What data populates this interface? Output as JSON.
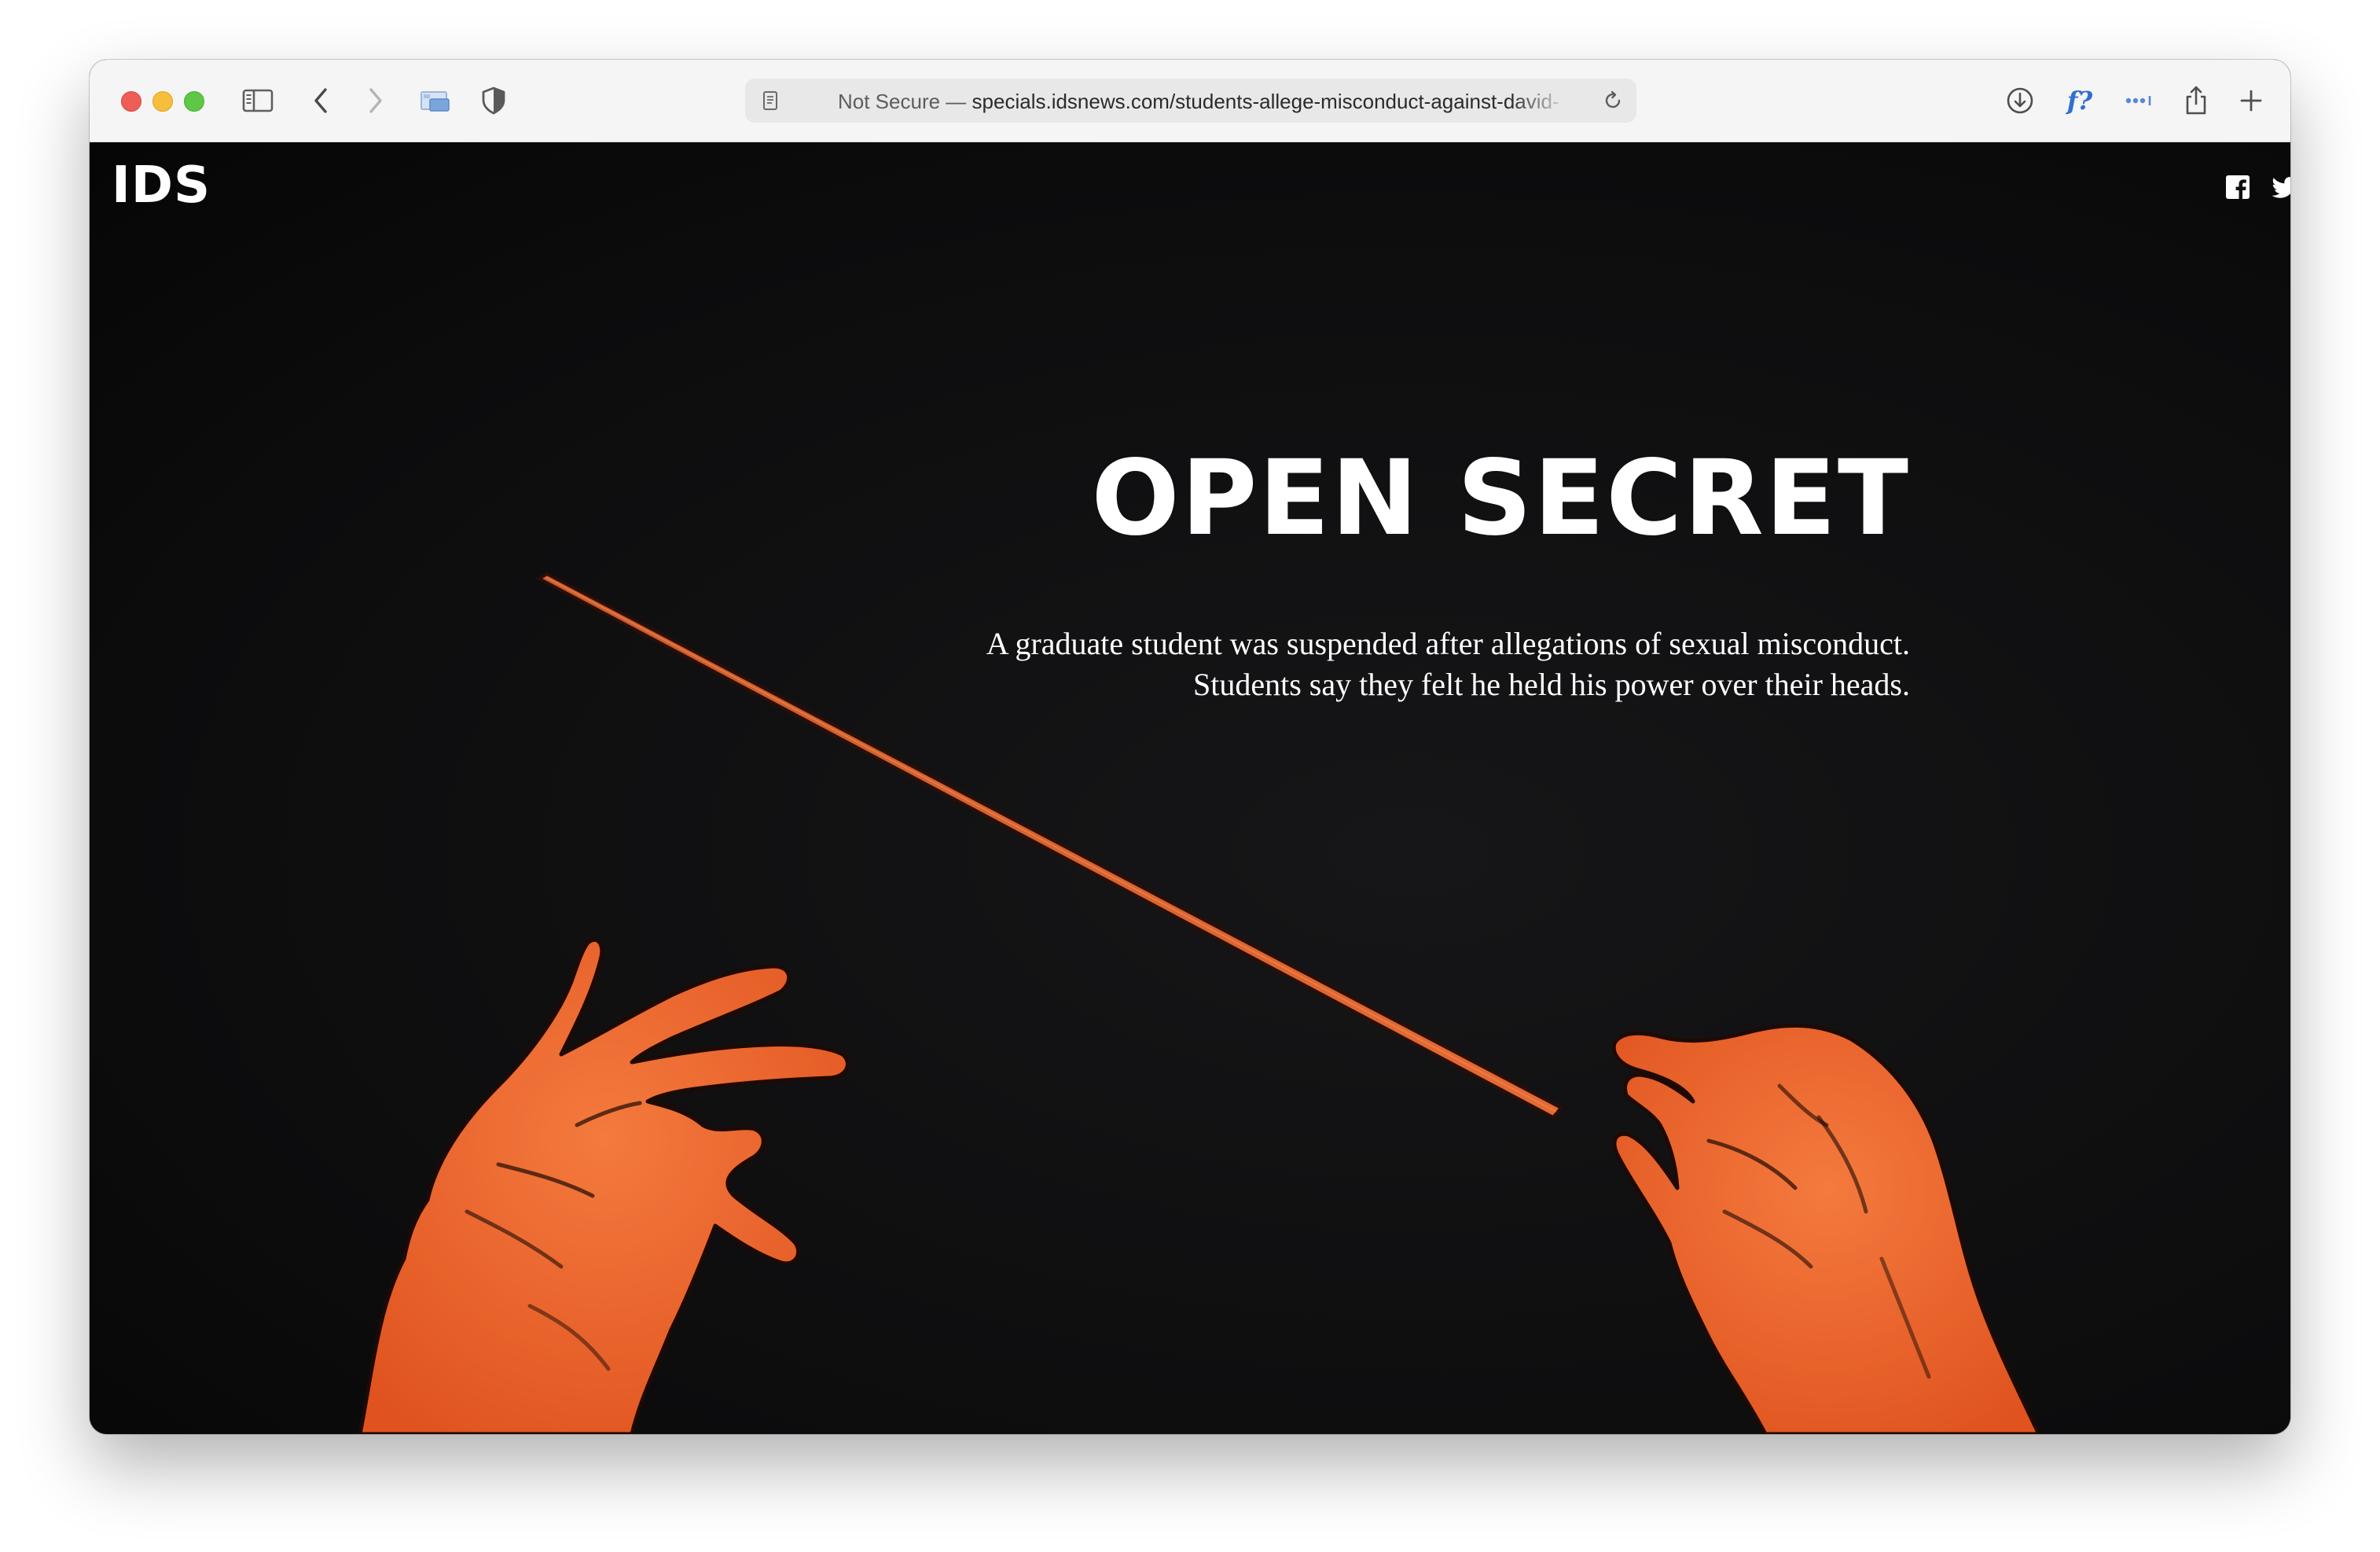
{
  "browser": {
    "url_prefix": "Not Secure —",
    "url": "specials.idsnews.com/students-allege-misconduct-against-david-",
    "icons": [
      "sidebar-icon",
      "back-icon",
      "forward-icon",
      "tab-group-icon",
      "privacy-shield-icon",
      "page-icon",
      "reload-icon",
      "download-icon",
      "font-icon",
      "more-icon",
      "share-icon",
      "new-tab-icon"
    ],
    "font_button_label": "f?"
  },
  "site": {
    "logo": "IDS",
    "social": [
      "facebook-icon",
      "twitter-icon"
    ]
  },
  "hero": {
    "headline": "OPEN SECRET",
    "dek_line1": "A graduate student was suspended after allegations of sexual misconduct.",
    "dek_line2": "Students say they felt he held his power over their heads.",
    "illustration": "orange-conductor-hands-with-baton",
    "colors": {
      "background": "#0f0f10",
      "hands": "#f2622c",
      "text": "#ffffff"
    }
  }
}
